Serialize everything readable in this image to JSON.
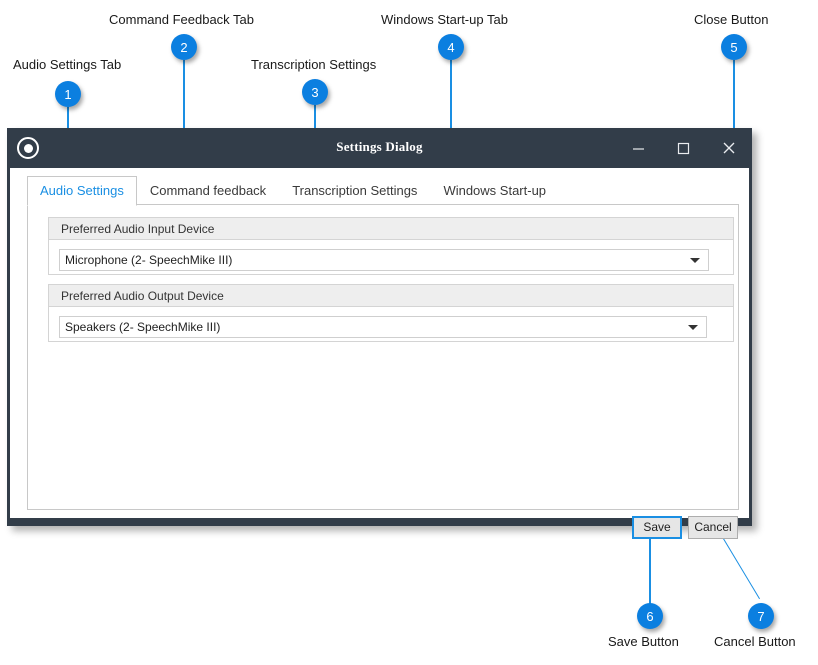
{
  "annotations": [
    {
      "id": 1,
      "number": "1",
      "label": "Audio Settings Tab"
    },
    {
      "id": 2,
      "number": "2",
      "label": "Command Feedback Tab"
    },
    {
      "id": 3,
      "number": "3",
      "label": "Transcription Settings"
    },
    {
      "id": 4,
      "number": "4",
      "label": "Windows Start-up Tab"
    },
    {
      "id": 5,
      "number": "5",
      "label": "Close Button"
    },
    {
      "id": 6,
      "number": "6",
      "label": "Save Button"
    },
    {
      "id": 7,
      "number": "7",
      "label": "Cancel Button"
    }
  ],
  "dialog": {
    "title": "Settings Dialog",
    "icon": "record-circle-icon",
    "window_controls": {
      "minimize": "─",
      "maximize": "□",
      "close": "✕"
    },
    "tabs": [
      {
        "label": "Audio Settings",
        "active": true
      },
      {
        "label": "Command feedback",
        "active": false
      },
      {
        "label": "Transcription Settings",
        "active": false
      },
      {
        "label": "Windows Start-up",
        "active": false
      }
    ],
    "groups": [
      {
        "header": "Preferred Audio Input Device",
        "combo_value": "Microphone (2- SpeechMike III)"
      },
      {
        "header": "Preferred Audio Output Device",
        "combo_value": "Speakers (2- SpeechMike III)"
      }
    ],
    "buttons": {
      "save": "Save",
      "cancel": "Cancel"
    }
  },
  "colors": {
    "titlebar": "#323d49",
    "accent_blue": "#1a8fe3",
    "badge_blue": "#0b7fe0",
    "group_header": "#eeeeee",
    "panel_border": "#c8c8c8"
  }
}
